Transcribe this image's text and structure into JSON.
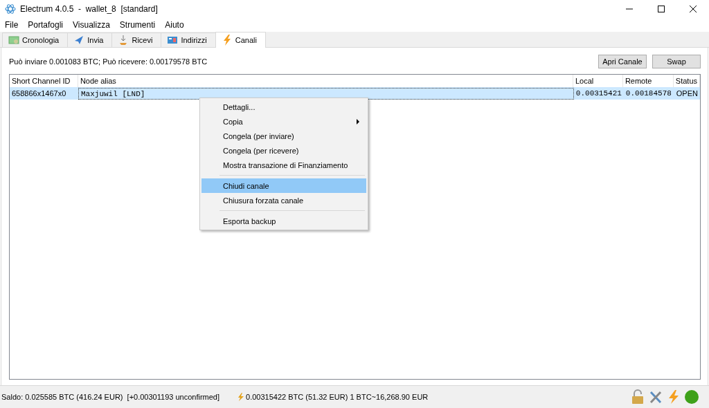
{
  "window": {
    "title": "Electrum 4.0.5  -  wallet_8  [standard]"
  },
  "menu": [
    "File",
    "Portafogli",
    "Visualizza",
    "Strumenti",
    "Aiuto"
  ],
  "tabs": [
    {
      "label": "Cronologia",
      "selected": false
    },
    {
      "label": "Invia",
      "selected": false
    },
    {
      "label": "Ricevi",
      "selected": false
    },
    {
      "label": "Indirizzi",
      "selected": false
    },
    {
      "label": "Canali",
      "selected": true
    }
  ],
  "summary": "Può inviare 0.001083 BTC; Può ricevere: 0.00179578 BTC",
  "buttons": [
    "Apri Canale",
    "Swap"
  ],
  "table": {
    "columns": [
      "Short Channel ID",
      "Node alias",
      "Local",
      "Remote",
      "Status"
    ],
    "rows": [
      {
        "cells": [
          "658866x1467x0",
          "Maxjuwil [LND]",
          "0.00315421",
          "0.00184578",
          "OPEN"
        ],
        "selected": true
      }
    ]
  },
  "context_menu": {
    "items": [
      {
        "label": "Dettagli...",
        "submenu": false,
        "selected": false
      },
      {
        "label": "Copia",
        "submenu": true,
        "selected": false
      },
      {
        "label": "Congela (per inviare)",
        "submenu": false,
        "selected": false
      },
      {
        "label": "Congela (per ricevere)",
        "submenu": false,
        "selected": false
      },
      {
        "label": "Mostra transazione di Finanziamento",
        "submenu": false,
        "selected": false
      },
      {
        "kind": "separator"
      },
      {
        "label": "Chiudi canale",
        "submenu": false,
        "selected": true
      },
      {
        "label": "Chiusura forzata canale",
        "submenu": false,
        "selected": false
      },
      {
        "kind": "separator"
      },
      {
        "label": "Esporta backup",
        "submenu": false,
        "selected": false
      }
    ]
  },
  "status_bar": {
    "balance": "Saldo: 0.025585 BTC (416.24 EUR)  [+0.00301193 unconfirmed]",
    "lightning": "0.00315422 BTC (51.32 EUR) 1 BTC~16,268.90 EUR"
  }
}
